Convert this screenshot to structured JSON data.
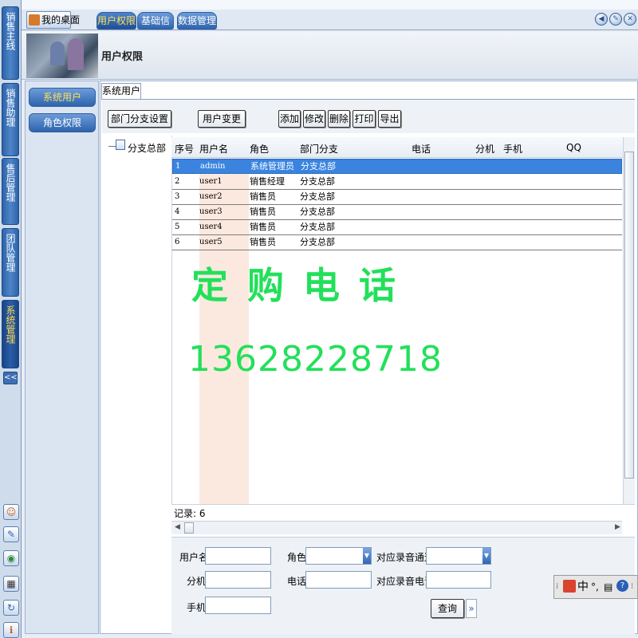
{
  "left_nav": {
    "tabs": [
      "销售主线",
      "销售助理",
      "售后管理",
      "团队管理",
      "系统管理"
    ],
    "active_tab": "系统管理",
    "collapse_label": "<<",
    "quick_icons": [
      "user-icon",
      "pencil-note-icon",
      "globe-icon",
      "calculator-icon",
      "refresh-icon",
      "info-icon"
    ]
  },
  "top_bar": {
    "desktop_label": "我的桌面",
    "tabs": [
      "用户权限",
      "基础信息",
      "数据管理"
    ],
    "active_tab": "用户权限",
    "right_icons": [
      "back-icon",
      "edit-icon",
      "close-icon"
    ],
    "right_icon_glyphs": [
      "◀",
      "✎",
      "✕"
    ]
  },
  "page_title": "用户权限",
  "side_menu": {
    "items": [
      "系统用户",
      "角色权限"
    ],
    "active": "系统用户"
  },
  "content_tab": "系统用户",
  "toolbar": {
    "dept_branch_settings": "部门分支设置",
    "user_change": "用户变更",
    "add": "添加",
    "modify": "修改",
    "delete": "删除",
    "print": "打印",
    "export": "导出"
  },
  "tree": {
    "root": "分支总部"
  },
  "grid": {
    "columns": [
      "序号",
      "用户名",
      "角色",
      "部门分支",
      "电话",
      "分机",
      "手机",
      "QQ"
    ],
    "rows": [
      {
        "no": "1",
        "username": "admin",
        "role": "系统管理员",
        "dept": "分支总部"
      },
      {
        "no": "2",
        "username": "user1",
        "role": "销售经理",
        "dept": "分支总部"
      },
      {
        "no": "3",
        "username": "user2",
        "role": "销售员",
        "dept": "分支总部"
      },
      {
        "no": "4",
        "username": "user3",
        "role": "销售员",
        "dept": "分支总部"
      },
      {
        "no": "5",
        "username": "user4",
        "role": "销售员",
        "dept": "分支总部"
      },
      {
        "no": "6",
        "username": "user5",
        "role": "销售员",
        "dept": "分支总部"
      }
    ],
    "selected_row": 1,
    "record_label": "记录: 6"
  },
  "watermark": {
    "line1": "定购电话",
    "line2": "13628228718"
  },
  "search_form": {
    "username_label": "用户名",
    "role_label": "角色",
    "record_channel_label": "对应录音通道",
    "ext_label": "分机",
    "phone_label": "电话",
    "record_phone_label": "对应录音电话",
    "mobile_label": "手机",
    "query_button": "查询",
    "more_button": "»"
  },
  "ime_bar": {
    "mode": "中",
    "punct": "°,",
    "help": "?"
  },
  "colors": {
    "accent_blue": "#2f64ad",
    "active_tab_text": "#ffe25a",
    "selected_row": "#3a84e0",
    "watermark_green": "#22e05a"
  }
}
